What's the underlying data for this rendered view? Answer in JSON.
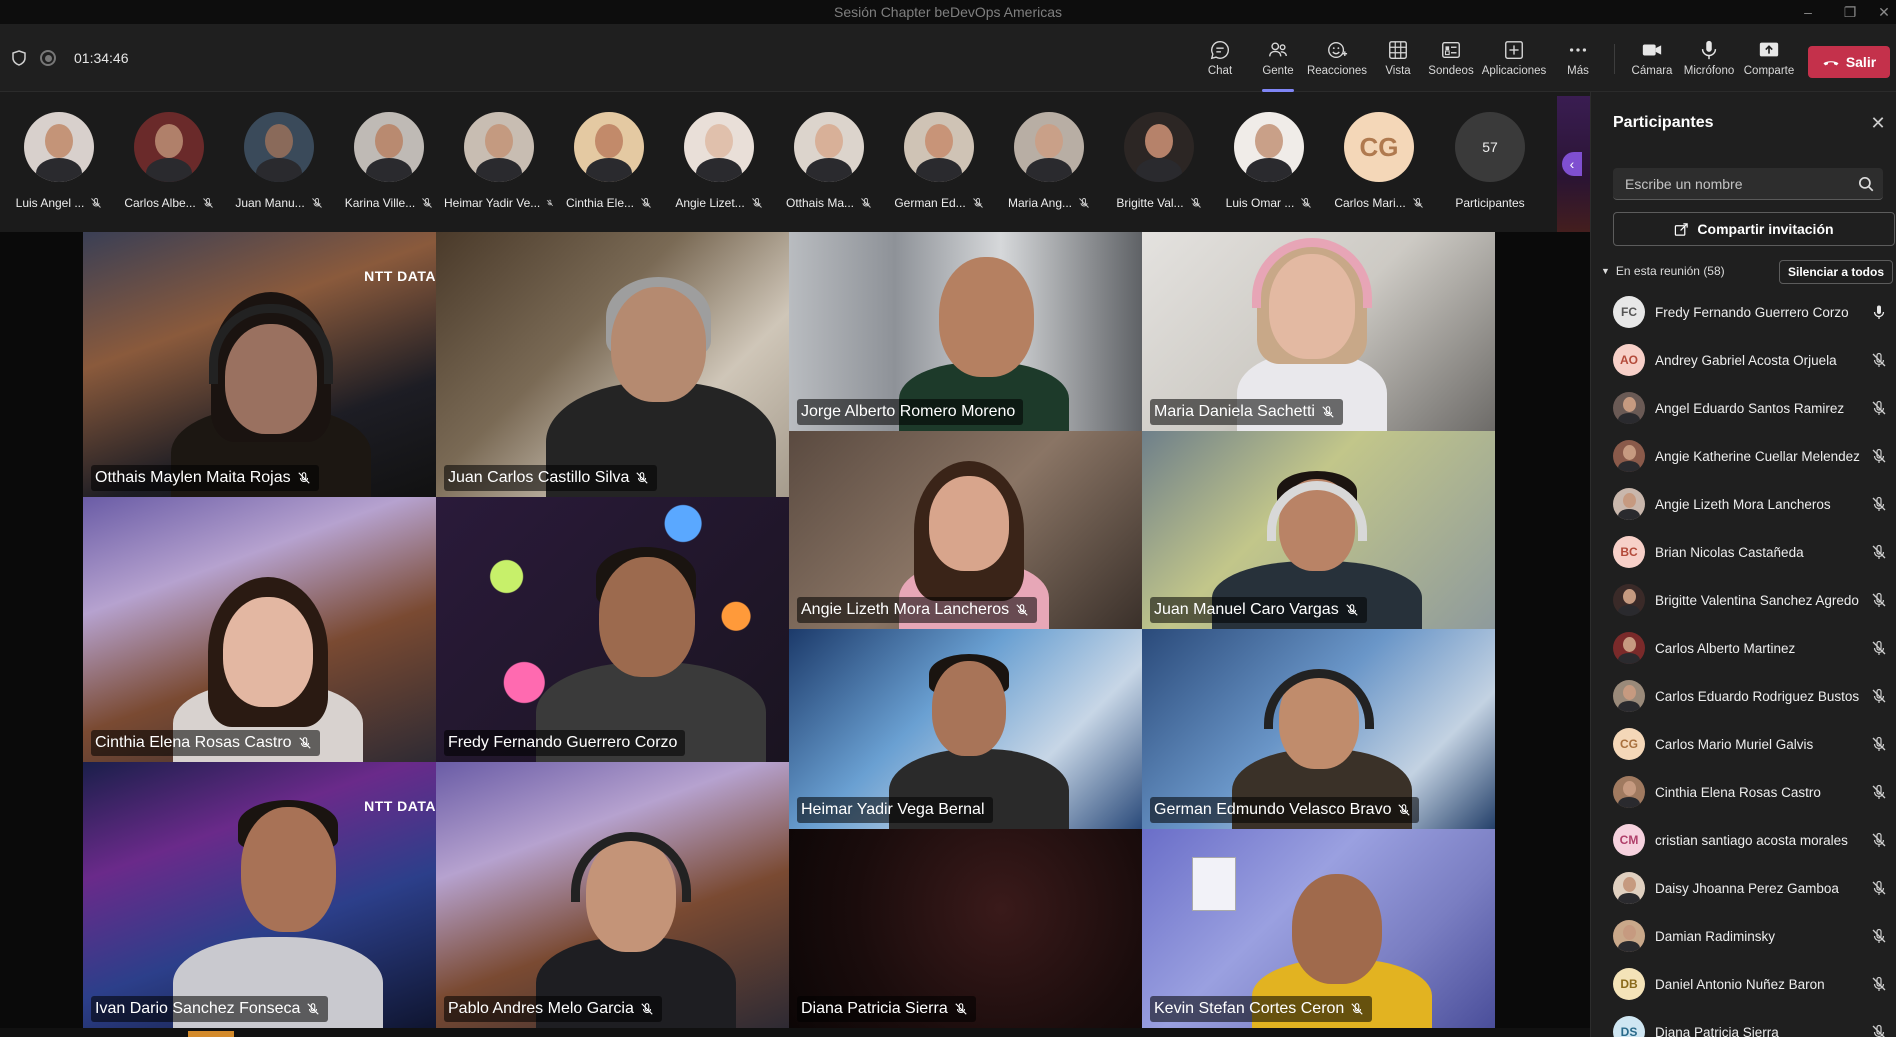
{
  "window": {
    "title": "Sesión Chapter beDevOps Americas",
    "controls": [
      "minimize",
      "restore",
      "close"
    ]
  },
  "toolbar": {
    "timer": "01:34:46",
    "buttons": [
      {
        "label": "Chat",
        "icon": "chat-icon"
      },
      {
        "label": "Gente",
        "icon": "people-icon",
        "active": true
      },
      {
        "label": "Reacciones",
        "icon": "reactions-icon"
      },
      {
        "label": "Vista",
        "icon": "grid-view-icon"
      },
      {
        "label": "Sondeos",
        "icon": "polls-icon"
      },
      {
        "label": "Aplicaciones",
        "icon": "apps-icon"
      },
      {
        "label": "Más",
        "icon": "more-icon"
      },
      {
        "label": "Cámara",
        "icon": "camera-icon"
      },
      {
        "label": "Micrófono",
        "icon": "microphone-icon"
      },
      {
        "label": "Comparte",
        "icon": "share-icon"
      }
    ],
    "leave_label": "Salir"
  },
  "strip": {
    "participants": [
      {
        "label": "Luis Angel ..."
      },
      {
        "label": "Carlos Albe..."
      },
      {
        "label": "Juan Manu..."
      },
      {
        "label": "Karina Ville..."
      },
      {
        "label": "Heimar Yadir Ve..."
      },
      {
        "label": "Cinthia Ele..."
      },
      {
        "label": "Angie Lizet..."
      },
      {
        "label": "Otthais Ma..."
      },
      {
        "label": "German Ed..."
      },
      {
        "label": "Maria Ang..."
      },
      {
        "label": "Brigitte Val..."
      },
      {
        "label": "Luis Omar ..."
      },
      {
        "label": "Carlos Mari...",
        "initials": "CG"
      }
    ],
    "more_count": "57",
    "more_label": "Participantes"
  },
  "grid": {
    "tiles": [
      {
        "name": "Otthais Maylen Maita Rojas",
        "brand": "NTT DATA"
      },
      {
        "name": "Juan Carlos Castillo Silva"
      },
      {
        "name": "Jorge Alberto Romero Moreno"
      },
      {
        "name": "Maria Daniela Sachetti"
      },
      {
        "name": "Angie Lizeth Mora Lancheros"
      },
      {
        "name": "Juan Manuel Caro Vargas"
      },
      {
        "name": "Cinthia Elena Rosas Castro"
      },
      {
        "name": "Fredy Fernando Guerrero Corzo"
      },
      {
        "name": "Heimar Yadir Vega Bernal"
      },
      {
        "name": "German Edmundo Velasco Bravo"
      },
      {
        "name": "Ivan Dario Sanchez Fonseca",
        "brand": "NTT DATA"
      },
      {
        "name": "Pablo Andres Melo Garcia"
      },
      {
        "name": "Diana Patricia Sierra"
      },
      {
        "name": "Kevin Stefan Cortes Ceron"
      }
    ]
  },
  "panel": {
    "title": "Participantes",
    "search_placeholder": "Escribe un nombre",
    "invite_label": "Compartir invitación",
    "section_label": "En esta reunión (58)",
    "mute_all_label": "Silenciar a todos",
    "people": [
      {
        "name": "Fredy Fernando Guerrero Corzo",
        "initials": "FC",
        "mic": "on"
      },
      {
        "name": "Andrey Gabriel Acosta Orjuela",
        "initials": "AO",
        "mic": "off"
      },
      {
        "name": "Angel Eduardo Santos Ramirez",
        "photo": true,
        "mic": "off"
      },
      {
        "name": "Angie Katherine Cuellar Melendez",
        "photo": true,
        "mic": "off"
      },
      {
        "name": "Angie Lizeth Mora Lancheros",
        "photo": true,
        "mic": "off"
      },
      {
        "name": "Brian Nicolas Castañeda",
        "initials": "BC",
        "mic": "off"
      },
      {
        "name": "Brigitte Valentina Sanchez Agredo",
        "photo": true,
        "mic": "off"
      },
      {
        "name": "Carlos Alberto Martinez",
        "photo": true,
        "mic": "off"
      },
      {
        "name": "Carlos Eduardo Rodriguez Bustos",
        "photo": true,
        "mic": "off"
      },
      {
        "name": "Carlos Mario Muriel Galvis",
        "initials": "CG",
        "mic": "off"
      },
      {
        "name": "Cinthia Elena Rosas Castro",
        "photo": true,
        "mic": "off"
      },
      {
        "name": "cristian santiago acosta morales",
        "initials": "CM",
        "mic": "off"
      },
      {
        "name": "Daisy Jhoanna Perez Gamboa",
        "photo": true,
        "mic": "off"
      },
      {
        "name": "Damian Radiminsky",
        "photo": true,
        "mic": "off"
      },
      {
        "name": "Daniel Antonio Nuñez Baron",
        "initials": "DB",
        "mic": "off"
      },
      {
        "name": "Diana Patricia Sierra",
        "initials": "DS",
        "mic": "off"
      }
    ]
  },
  "colors": {
    "accent": "#7f85f5",
    "leave": "#c4314b",
    "toolbar_bg": "#1f1f1f",
    "panel_bg": "#1f1f1f"
  }
}
